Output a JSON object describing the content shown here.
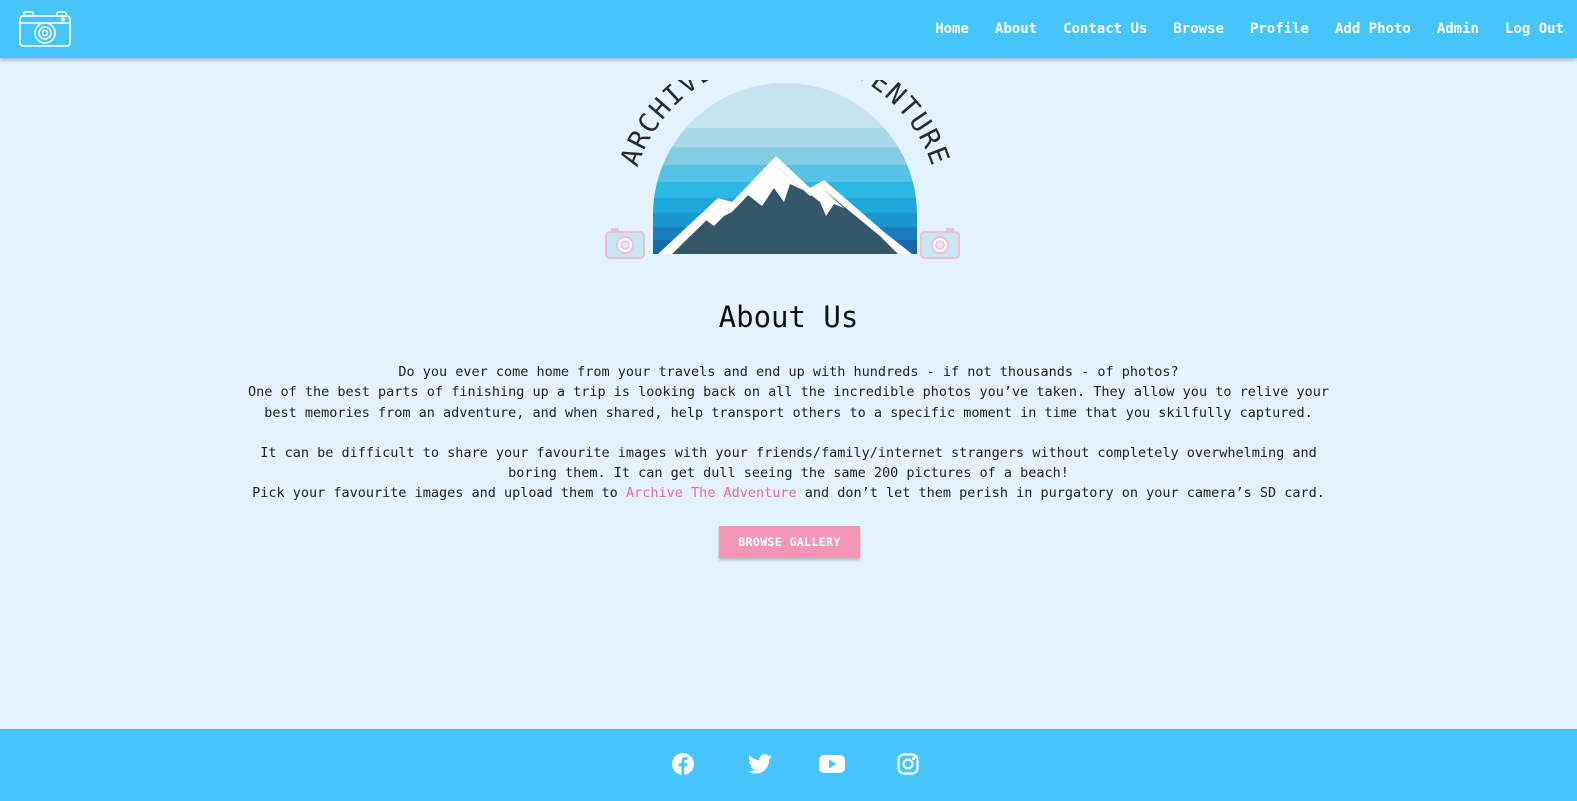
{
  "colors": {
    "navbar_bg": "#45c5fb",
    "page_bg": "#e3f2fc",
    "accent_pink": "#f497b7",
    "link_pink": "#f0679a",
    "mountain_dark": "#355868"
  },
  "navbar": {
    "logo_icon": "camera-icon",
    "links": [
      "Home",
      "About",
      "Contact Us",
      "Browse",
      "Profile",
      "Add Photo",
      "Admin",
      "Log Out"
    ]
  },
  "hero": {
    "logo_text": "ARCHIVE YOUR ADVENTURE"
  },
  "about": {
    "title": "About Us",
    "paragraph1_line1": "Do you ever come home from your travels and end up with hundreds - if not thousands - of photos?",
    "paragraph1_line2": "One of the best parts of finishing up a trip is looking back on all the incredible photos you’ve taken. They allow you to relive your best memories from an adventure, and when shared, help transport others to a specific moment in time that you skilfully captured.",
    "paragraph2_line1": "It can be difficult to share your favourite images with your friends/family/internet strangers without completely overwhelming and boring them. It can get dull seeing the same 200 pictures of a beach!",
    "paragraph2_pre": "Pick your favourite images and upload them to ",
    "paragraph2_link": "Archive The Adventure",
    "paragraph2_post": " and don’t let them perish in purgatory on your camera’s SD card.",
    "button_label": "BROWSE GALLERY"
  },
  "footer": {
    "social_icons": [
      "facebook-icon",
      "twitter-icon",
      "youtube-icon",
      "instagram-icon"
    ]
  }
}
